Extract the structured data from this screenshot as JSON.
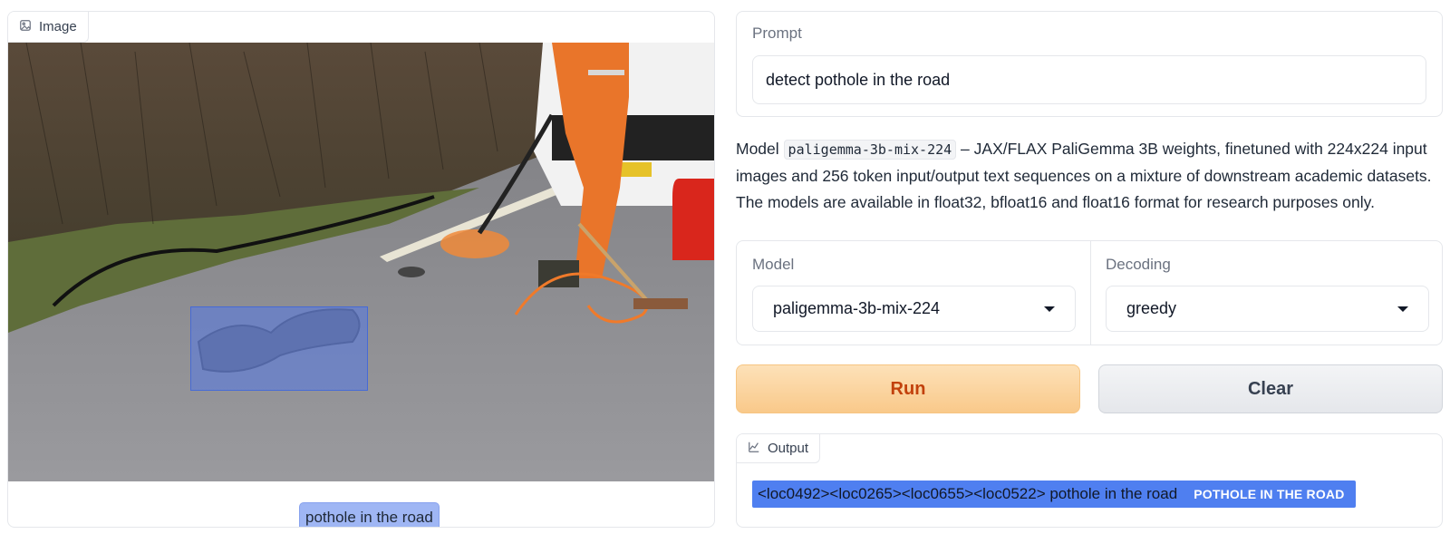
{
  "image_block": {
    "label": "Image",
    "annotation_label": "pothole in the road"
  },
  "prompt": {
    "label": "Prompt",
    "value": "detect pothole in the road"
  },
  "description": {
    "prefix": "Model",
    "model_code": "paligemma-3b-mix-224",
    "text": "– JAX/FLAX PaliGemma 3B weights, finetuned with 224x224 input images and 256 token input/output text sequences on a mixture of downstream academic datasets. The models are available in float32, bfloat16 and float16 format for research purposes only."
  },
  "settings": {
    "model_label": "Model",
    "model_value": "paligemma-3b-mix-224",
    "decoding_label": "Decoding",
    "decoding_value": "greedy"
  },
  "buttons": {
    "run": "Run",
    "clear": "Clear"
  },
  "output": {
    "label": "Output",
    "text": "<loc0492><loc0265><loc0655><loc0522> pothole in the road",
    "badge": "POTHOLE IN THE ROAD"
  },
  "colors": {
    "run_accent": "#c2410c",
    "bbox_highlight": "#5478e6",
    "output_highlight": "#4f7ff0"
  }
}
